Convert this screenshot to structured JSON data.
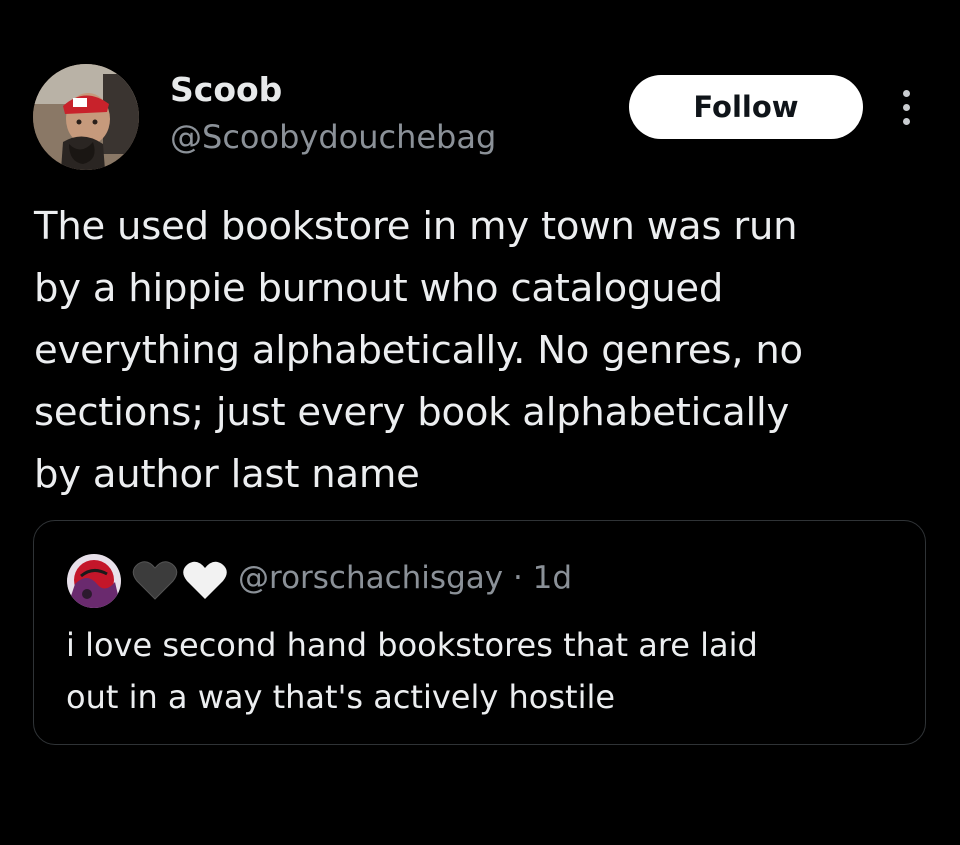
{
  "author": {
    "display_name": "Scoob",
    "handle": "@Scoobydouchebag",
    "avatar_icon": "profile-avatar"
  },
  "actions": {
    "follow_label": "Follow",
    "more_icon": "vertical-ellipsis-icon"
  },
  "tweet": {
    "text": "The used bookstore in my town was run\nby a hippie burnout who catalogued\neverything alphabetically. No genres, no\nsections; just every book alphabetically\nby author last name"
  },
  "quoted_tweet": {
    "handle": "@rorschachisgay",
    "separator": "·",
    "time": "1d",
    "name_emoji": [
      "black-heart-icon",
      "white-heart-icon"
    ],
    "text": "i love second hand bookstores that are laid\nout in a way that's actively hostile"
  },
  "colors": {
    "background": "#000000",
    "text_primary": "#e7e9ea",
    "text_secondary": "#8b9198",
    "follow_bg": "#ffffff",
    "border": "#2f3336"
  }
}
